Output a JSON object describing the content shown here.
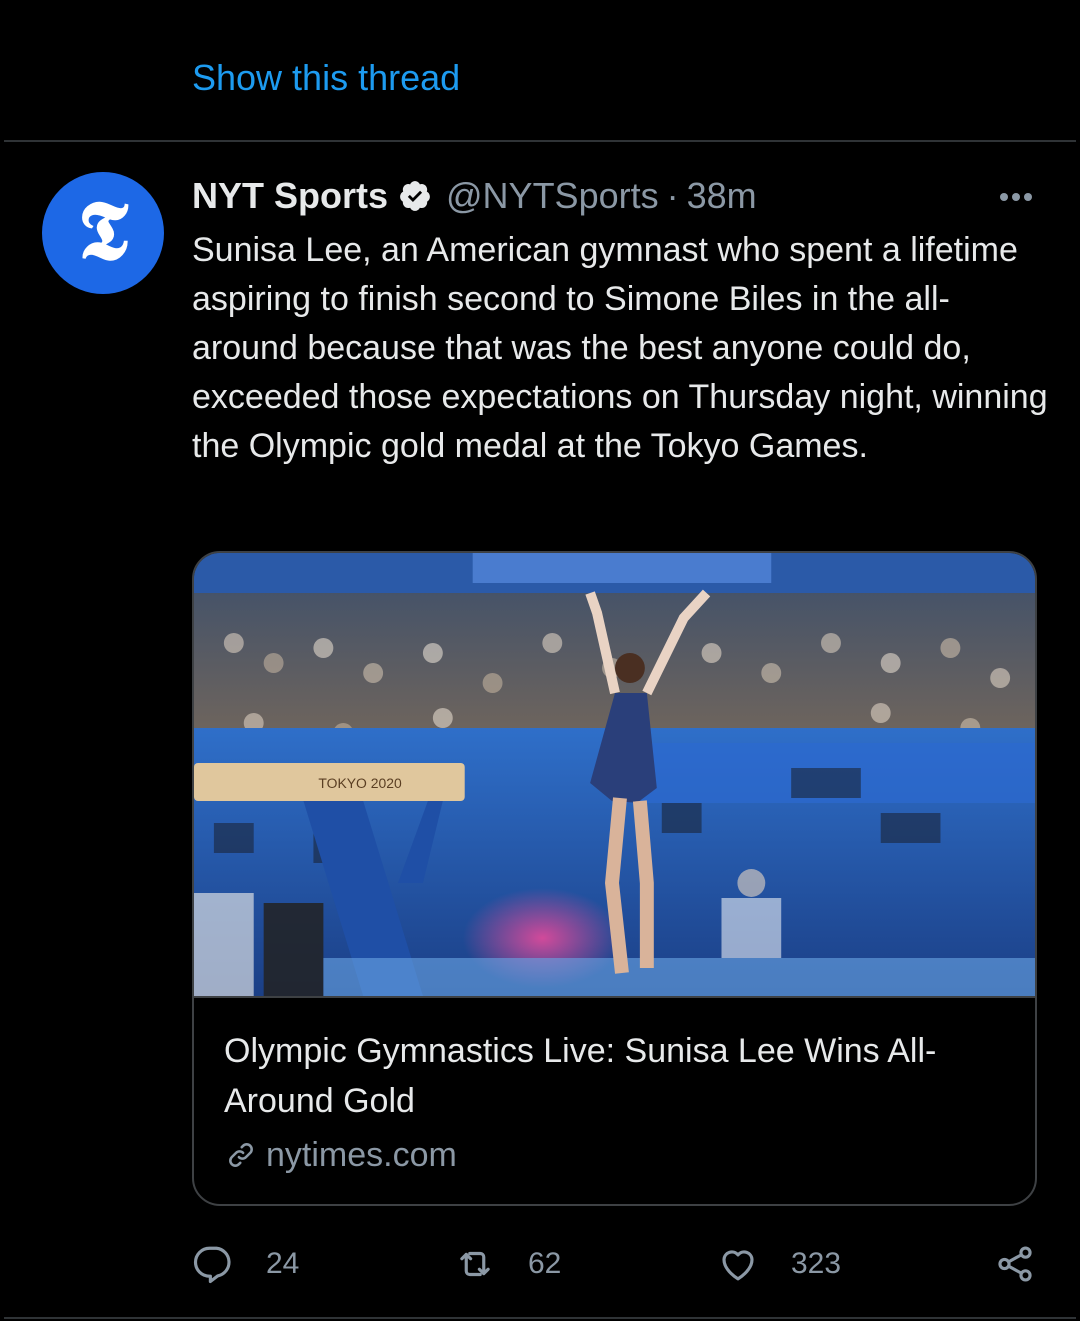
{
  "thread": {
    "show_label": "Show this thread"
  },
  "tweet": {
    "author": {
      "display_name": "NYT Sports",
      "handle": "@NYTSports",
      "verified": true,
      "avatar_letter": "𝕿"
    },
    "separator": "·",
    "time": "38m",
    "text": "Sunisa Lee, an American gymnast who spent a lifetime aspiring to finish second to Simone Biles in the all-around because that was the best anyone could do, exceeded those expectations on Thursday night, winning the Olympic gold medal at the Tokyo Games.",
    "card": {
      "image_alt": "Gymnast celebrating after balance beam routine",
      "beam_label": "TOKYO 2020",
      "title": "Olympic Gymnastics Live: Sunisa Lee Wins All-Around Gold",
      "domain": "nytimes.com"
    },
    "actions": {
      "replies": "24",
      "retweets": "62",
      "likes": "323"
    }
  },
  "colors": {
    "background": "#000000",
    "text": "#e7e9ea",
    "secondary": "#8b98a5",
    "accent": "#1d9bf0",
    "avatar_bg": "#1d68e6",
    "border": "#3e4144"
  },
  "icons": {
    "verified": "verified-badge-icon",
    "more": "more-horizontal-icon",
    "link": "link-icon",
    "reply": "reply-icon",
    "retweet": "retweet-icon",
    "like": "heart-icon",
    "share": "share-icon"
  }
}
